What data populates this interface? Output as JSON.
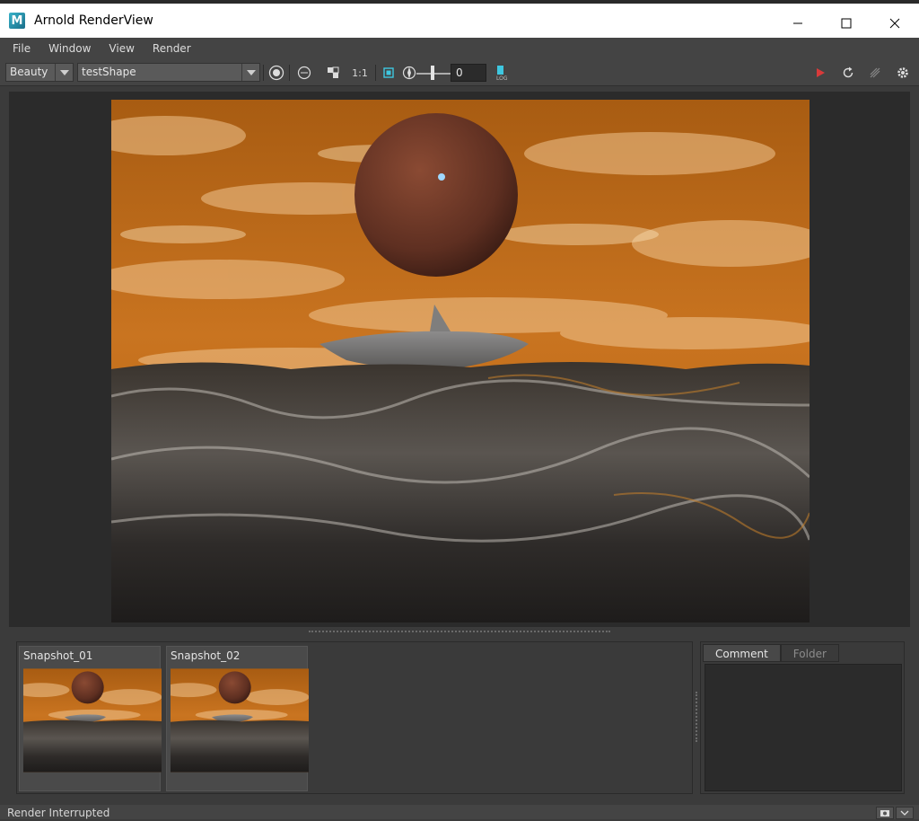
{
  "window": {
    "title": "Arnold RenderView",
    "logo_letter": "M"
  },
  "menu": {
    "items": [
      "File",
      "Window",
      "View",
      "Render"
    ]
  },
  "toolbar": {
    "aov_value": "Beauty",
    "camera_value": "testShape",
    "zoom_label": "1:1",
    "exposure_value": "0",
    "icons": [
      "display-settings-icon",
      "test-render-icon",
      "ab-compare-icon",
      "crop-region-icon",
      "exposure-icon",
      "lut-icon",
      "render-icon",
      "refresh-icon",
      "debug-shading-icon",
      "settings-icon"
    ],
    "accent_red": "#d83a3a"
  },
  "snapshots": [
    {
      "label": "Snapshot_01"
    },
    {
      "label": "Snapshot_02"
    }
  ],
  "side_tabs": {
    "comment": "Comment",
    "folder": "Folder"
  },
  "status": {
    "text": "Render Interrupted"
  }
}
